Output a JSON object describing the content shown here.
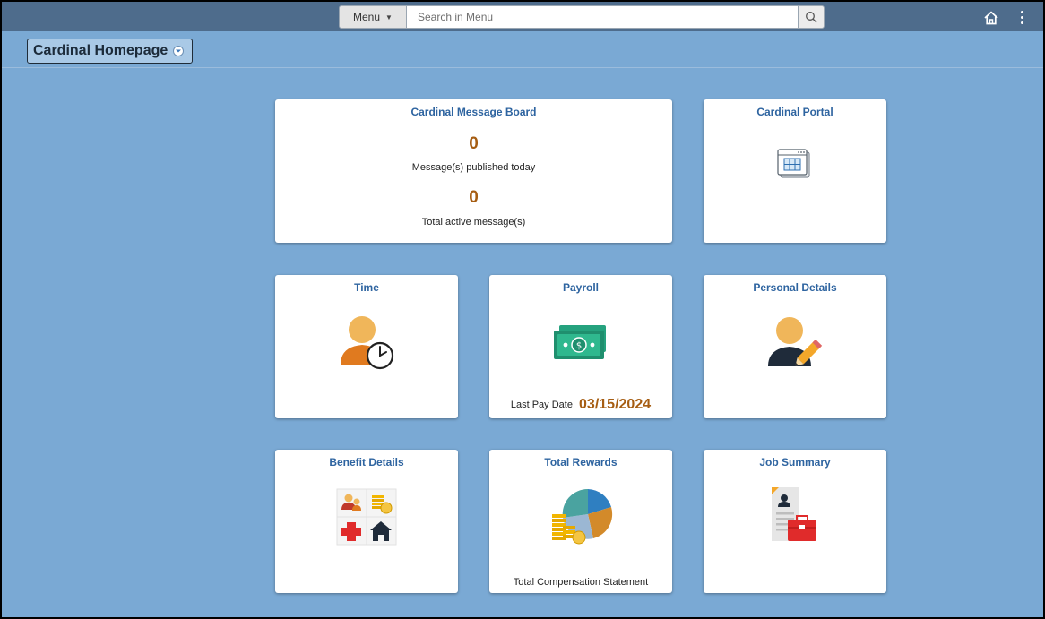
{
  "topbar": {
    "menu_label": "Menu",
    "search_placeholder": "Search in Menu"
  },
  "header": {
    "homepage_title": "Cardinal Homepage"
  },
  "tiles": {
    "message_board": {
      "title": "Cardinal Message Board",
      "published_count": "0",
      "published_label": "Message(s) published today",
      "active_count": "0",
      "active_label": "Total active message(s)"
    },
    "portal": {
      "title": "Cardinal Portal"
    },
    "time": {
      "title": "Time"
    },
    "payroll": {
      "title": "Payroll",
      "last_pay_label": "Last Pay Date",
      "last_pay_value": "03/15/2024"
    },
    "personal_details": {
      "title": "Personal Details"
    },
    "benefit_details": {
      "title": "Benefit Details"
    },
    "total_rewards": {
      "title": "Total Rewards",
      "footer": "Total Compensation Statement"
    },
    "job_summary": {
      "title": "Job Summary"
    }
  },
  "icons": {
    "search": "search-icon",
    "home": "home-icon",
    "actions": "actions-menu-icon",
    "dropdown": "chevron-down-icon",
    "portal": "portal-window-icon",
    "time": "person-clock-icon",
    "payroll": "money-bill-icon",
    "personal_details": "person-edit-icon",
    "benefit_details": "benefits-grid-icon",
    "total_rewards": "pie-chart-coins-icon",
    "job_summary": "resume-briefcase-icon"
  },
  "colors": {
    "page_background": "#7aa9d4",
    "topbar": "#4e6c8c",
    "tile_title": "#2e64a0",
    "accent_value": "#a65d12"
  }
}
